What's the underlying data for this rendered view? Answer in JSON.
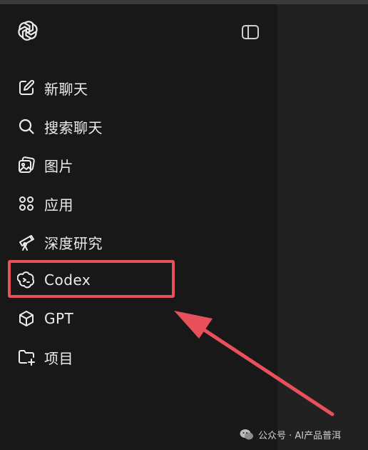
{
  "app": {
    "accent_color": "#e8505b"
  },
  "header": {
    "logo_icon": "openai-logo-icon",
    "toggle_icon": "sidebar-toggle-icon"
  },
  "sidebar": {
    "items": [
      {
        "label": "新聊天",
        "icon": "edit-icon"
      },
      {
        "label": "搜索聊天",
        "icon": "search-icon"
      },
      {
        "label": "图片",
        "icon": "image-icon"
      },
      {
        "label": "应用",
        "icon": "apps-icon"
      },
      {
        "label": "深度研究",
        "icon": "telescope-icon"
      },
      {
        "label": "Codex",
        "icon": "codex-icon"
      },
      {
        "label": "GPT",
        "icon": "cube-icon"
      },
      {
        "label": "项目",
        "icon": "folder-plus-icon"
      }
    ]
  },
  "watermark": {
    "text": "公众号 · AI产品普洱"
  }
}
